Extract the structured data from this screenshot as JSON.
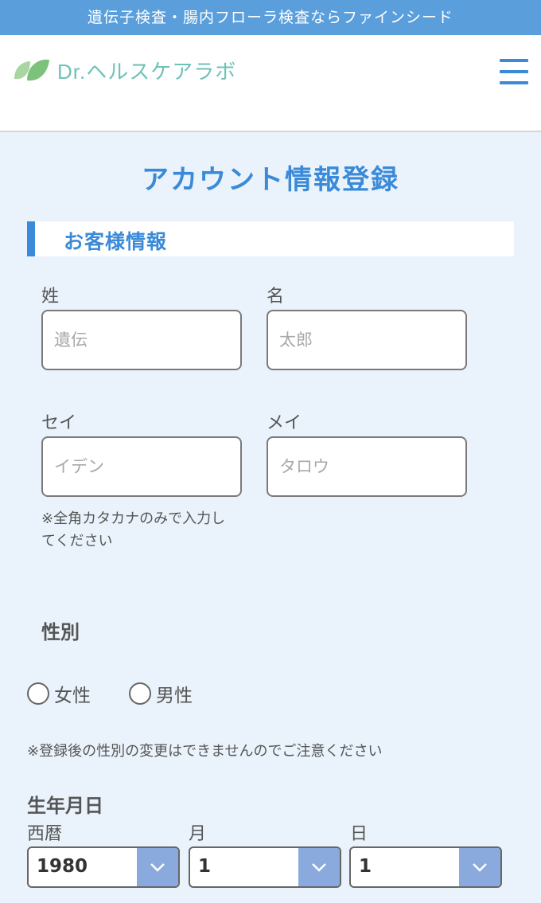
{
  "topbar": {
    "text": "遺伝子検査・腸内フローラ検査ならファインシード"
  },
  "header": {
    "logo_text": "Dr.ヘルスケアラボ",
    "accent": "#3a8ad8",
    "logo_color": "#6fc2b8"
  },
  "page": {
    "title": "アカウント情報登録"
  },
  "customer": {
    "section_title": "お客様情報",
    "last_name": {
      "label": "姓",
      "placeholder": "遺伝",
      "value": ""
    },
    "first_name": {
      "label": "名",
      "placeholder": "太郎",
      "value": ""
    },
    "last_name_kana": {
      "label": "セイ",
      "placeholder": "イデン",
      "value": ""
    },
    "first_name_kana": {
      "label": "メイ",
      "placeholder": "タロウ",
      "value": ""
    },
    "kana_note_line1": "※全角カタカナのみで入力し",
    "kana_note_line2": "てください"
  },
  "gender": {
    "label": "性別",
    "options": [
      "女性",
      "男性"
    ],
    "note": "※登録後の性別の変更はできませんのでご注意ください"
  },
  "birthday": {
    "label": "生年月日",
    "year": {
      "label": "西暦",
      "value": "1980"
    },
    "month": {
      "label": "月",
      "value": "1"
    },
    "day": {
      "label": "日",
      "value": "1"
    }
  }
}
